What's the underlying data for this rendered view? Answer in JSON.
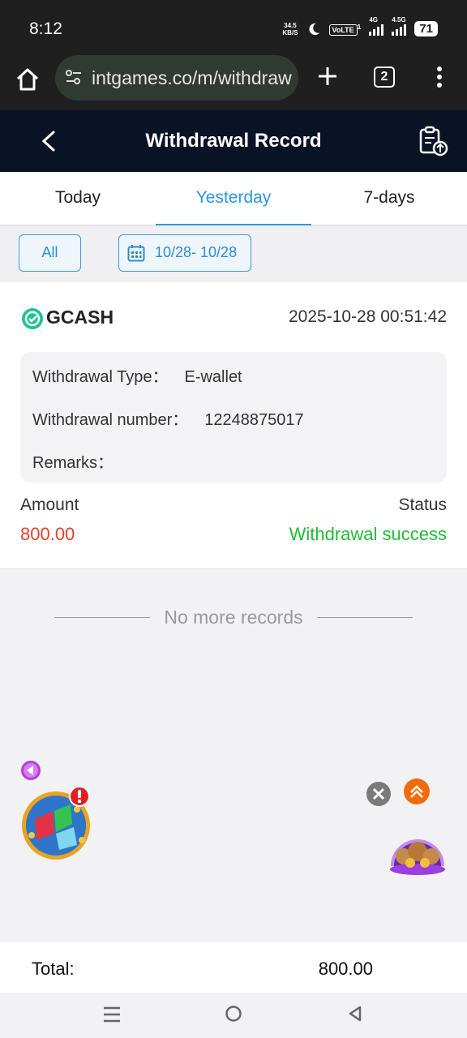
{
  "status_bar": {
    "time": "8:12",
    "net_speed_value": "34.5",
    "net_speed_unit": "KB/S",
    "volte": "VoLTE",
    "volte_sup": "1",
    "network_1": "4G",
    "network_2": "4.5G",
    "battery": "71"
  },
  "browser": {
    "url": "intgames.co/m/withdraw",
    "tab_count": "2"
  },
  "header": {
    "title": "Withdrawal Record"
  },
  "tabs": [
    {
      "label": "Today",
      "active": false
    },
    {
      "label": "Yesterday",
      "active": true
    },
    {
      "label": "7-days",
      "active": false
    }
  ],
  "filters": {
    "all_label": "All",
    "date_range": "10/28- 10/28"
  },
  "record": {
    "method": "GCASH",
    "datetime": "2025-10-28 00:51:42",
    "type_label": "Withdrawal Type：",
    "type_value": "E-wallet",
    "number_label": "Withdrawal number：",
    "number_value": "12248875017",
    "remarks_label": "Remarks：",
    "remarks_value": "",
    "amount_label": "Amount",
    "amount_value": "800.00",
    "status_label": "Status",
    "status_value": "Withdrawal success"
  },
  "no_more_text": "No more records",
  "total": {
    "label": "Total:",
    "value": "800.00"
  },
  "colors": {
    "accent": "#2b97db",
    "header_bg": "#0a1226",
    "amount": "#e4412c",
    "success": "#1fbb38"
  }
}
